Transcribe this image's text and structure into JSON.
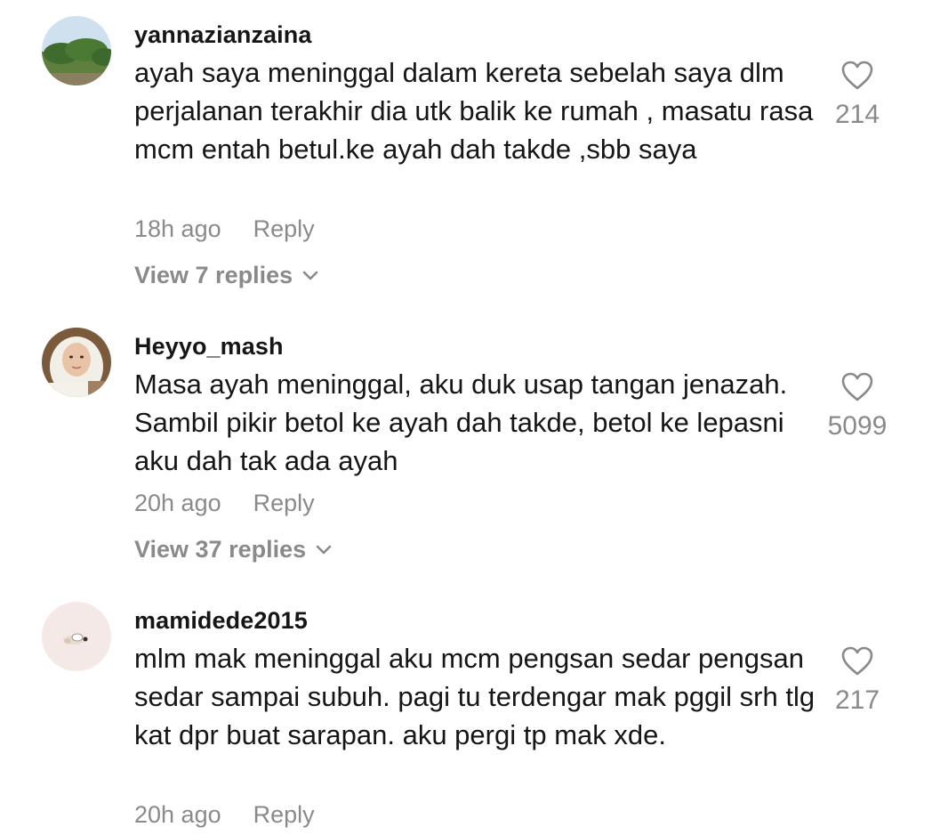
{
  "comments": [
    {
      "username": "yannazianzaina",
      "text": "ayah saya meninggal dalam kereta sebelah saya dlm perjalanan terakhir dia utk balik ke rumah , masatu rasa mcm entah betul.ke ayah dah takde ,sbb saya",
      "time": "18h ago",
      "reply_label": "Reply",
      "view_replies": "View 7 replies",
      "likes": "214"
    },
    {
      "username": "Heyyo_mash",
      "text": "Masa ayah meninggal, aku duk usap tangan jenazah. Sambil pikir betol ke ayah dah takde, betol ke lepasni aku dah tak ada ayah",
      "time": "20h ago",
      "reply_label": "Reply",
      "view_replies": "View 37 replies",
      "likes": "5099"
    },
    {
      "username": "mamidede2015",
      "text": "mlm mak meninggal aku mcm pengsan sedar pengsan sedar sampai subuh. pagi tu terdengar mak pggil srh tlg kat dpr buat sarapan. aku pergi tp mak xde.",
      "time": "20h ago",
      "reply_label": "Reply",
      "likes": "217"
    }
  ],
  "colors": {
    "text": "#161616",
    "secondary": "#8a8a8a",
    "background": "#ffffff"
  }
}
